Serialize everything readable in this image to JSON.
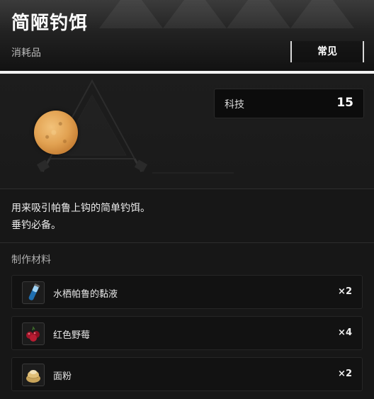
{
  "item": {
    "name": "简陋钓饵",
    "category": "消耗品",
    "rarity": "常见",
    "icon": "bait-ball-icon"
  },
  "tech": {
    "label": "科技",
    "value": "15"
  },
  "description": {
    "line1": "用来吸引帕鲁上钩的简单钓饵。",
    "line2": "垂钓必备。"
  },
  "materials": {
    "title": "制作材料",
    "items": [
      {
        "name": "水栖帕鲁的黏液",
        "qty": "×2",
        "icon": "slime-vial-icon"
      },
      {
        "name": "红色野莓",
        "qty": "×4",
        "icon": "red-berries-icon"
      },
      {
        "name": "面粉",
        "qty": "×2",
        "icon": "flour-sack-icon"
      }
    ]
  },
  "colors": {
    "background": "#171717",
    "header_top": "#3b3b3b",
    "accent_white": "#f2f2f2",
    "bait": "#e2a252"
  }
}
